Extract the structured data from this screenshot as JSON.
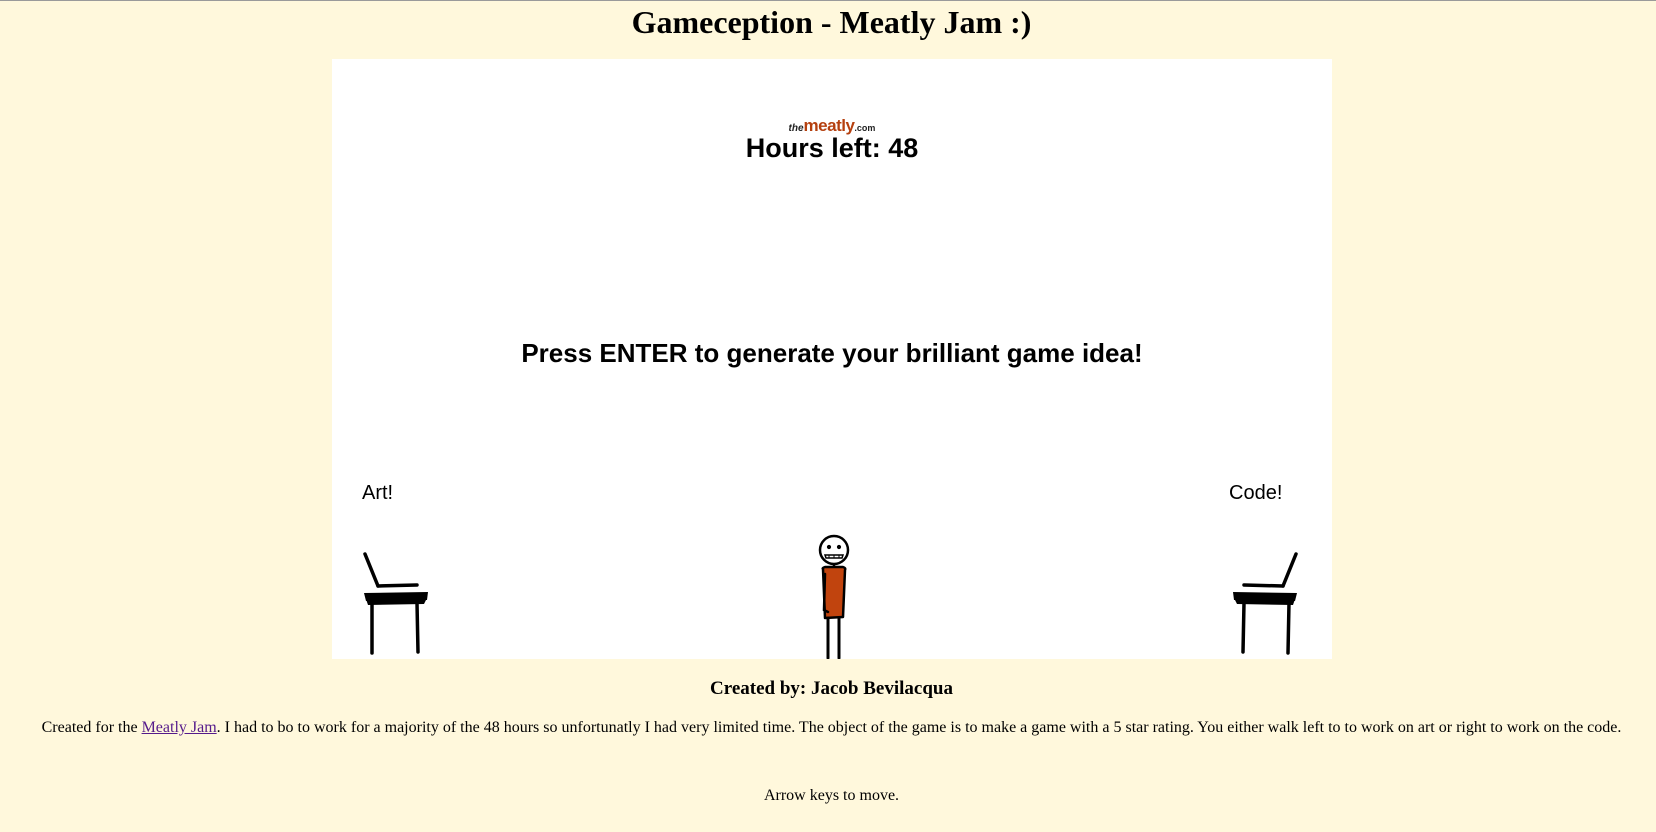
{
  "page": {
    "title": "Gameception - Meatly Jam :)"
  },
  "game": {
    "logo": {
      "prefix": "the",
      "main": "meatly",
      "suffix": ".com",
      "color": "#b5400f"
    },
    "hours_text": "Hours left: 48",
    "prompt_text": "Press ENTER to generate your brilliant game idea!",
    "left_zone_label": "Art!",
    "right_zone_label": "Code!",
    "player_shirt_color": "#c1440e",
    "background_color": "#ffffff"
  },
  "footer": {
    "credit": "Created by: Jacob Bevilacqua",
    "description_before_link": "Created for the ",
    "link_text": "Meatly Jam",
    "description_after_link": ". I had to bo to work for a majority of the 48 hours so unfortunatly I had very limited time. The object of the game is to make a game with a 5 star rating. You either walk left to to work on art or right to work on the code.",
    "controls": "Arrow keys to move."
  },
  "colors": {
    "page_background": "#fff8dc",
    "link": "#551a8b"
  }
}
